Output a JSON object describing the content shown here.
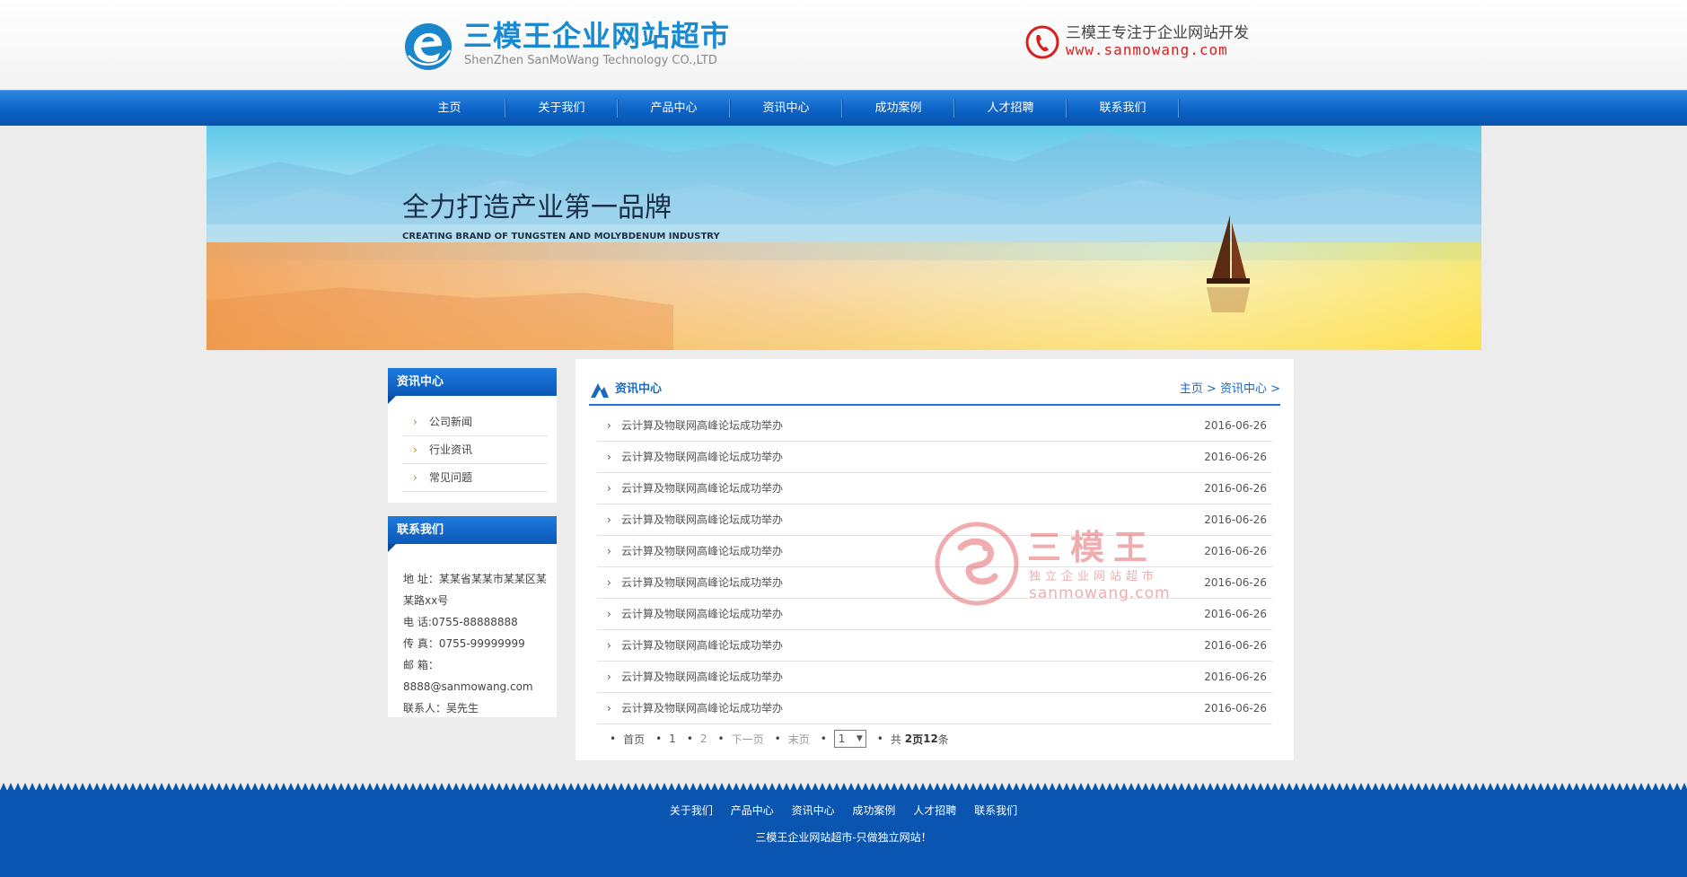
{
  "header": {
    "logo_title": "三模王企业网站超市",
    "logo_subtitle": "ShenZhen SanMoWang Technology CO.,LTD",
    "hotline_text": "三模王专注于企业网站开发",
    "hotline_url": "www.sanmowang.com"
  },
  "nav": {
    "items": [
      {
        "label": "主页"
      },
      {
        "label": "关于我们"
      },
      {
        "label": "产品中心"
      },
      {
        "label": "资讯中心"
      },
      {
        "label": "成功案例"
      },
      {
        "label": "人才招聘"
      },
      {
        "label": "联系我们"
      }
    ]
  },
  "banner": {
    "title": "全力打造产业第一品牌",
    "subtitle": "CREATING BRAND OF TUNGSTEN AND MOLYBDENUM INDUSTRY"
  },
  "sidebar": {
    "category_title": "资讯中心",
    "categories": [
      {
        "label": "公司新闻"
      },
      {
        "label": "行业资讯"
      },
      {
        "label": "常见问题"
      }
    ],
    "contact_title": "联系我们",
    "contact": {
      "address": "地 址：某某省某某市某某区某某路xx号",
      "phone": "电 话:0755-88888888",
      "fax": "传 真：0755-99999999",
      "email_label": "邮 箱：",
      "email": "8888@sanmowang.com",
      "person": "联系人：吴先生"
    }
  },
  "main": {
    "title": "资讯中心",
    "breadcrumb": {
      "home": "主页",
      "sep": ">",
      "section": "资讯中心"
    },
    "news": [
      {
        "title": "云计算及物联网高峰论坛成功举办",
        "date": "2016-06-26"
      },
      {
        "title": "云计算及物联网高峰论坛成功举办",
        "date": "2016-06-26"
      },
      {
        "title": "云计算及物联网高峰论坛成功举办",
        "date": "2016-06-26"
      },
      {
        "title": "云计算及物联网高峰论坛成功举办",
        "date": "2016-06-26"
      },
      {
        "title": "云计算及物联网高峰论坛成功举办",
        "date": "2016-06-26"
      },
      {
        "title": "云计算及物联网高峰论坛成功举办",
        "date": "2016-06-26"
      },
      {
        "title": "云计算及物联网高峰论坛成功举办",
        "date": "2016-06-26"
      },
      {
        "title": "云计算及物联网高峰论坛成功举办",
        "date": "2016-06-26"
      },
      {
        "title": "云计算及物联网高峰论坛成功举办",
        "date": "2016-06-26"
      },
      {
        "title": "云计算及物联网高峰论坛成功举办",
        "date": "2016-06-26"
      }
    ],
    "pager": {
      "first": "首页",
      "page1": "1",
      "page2": "2",
      "next": "下一页",
      "last": "末页",
      "selected_page": "1",
      "total_prefix": "共",
      "total_pages": "2",
      "total_pages_suffix": "页",
      "total_items": "12",
      "total_items_suffix": "条"
    }
  },
  "watermark": {
    "brand": "三模王",
    "tagline": "独立企业网站超市",
    "url": "sanmowang.com"
  },
  "footer": {
    "links": [
      {
        "label": "关于我们"
      },
      {
        "label": "产品中心"
      },
      {
        "label": "资讯中心"
      },
      {
        "label": "成功案例"
      },
      {
        "label": "人才招聘"
      },
      {
        "label": "联系我们"
      }
    ],
    "copyright": "三模王企业网站超市-只做独立网站！"
  },
  "colors": {
    "nav_blue": "#0c63c7",
    "brand_blue": "#1a8ad0",
    "accent_red": "#d7201f",
    "footer_blue": "#0a55b0"
  }
}
